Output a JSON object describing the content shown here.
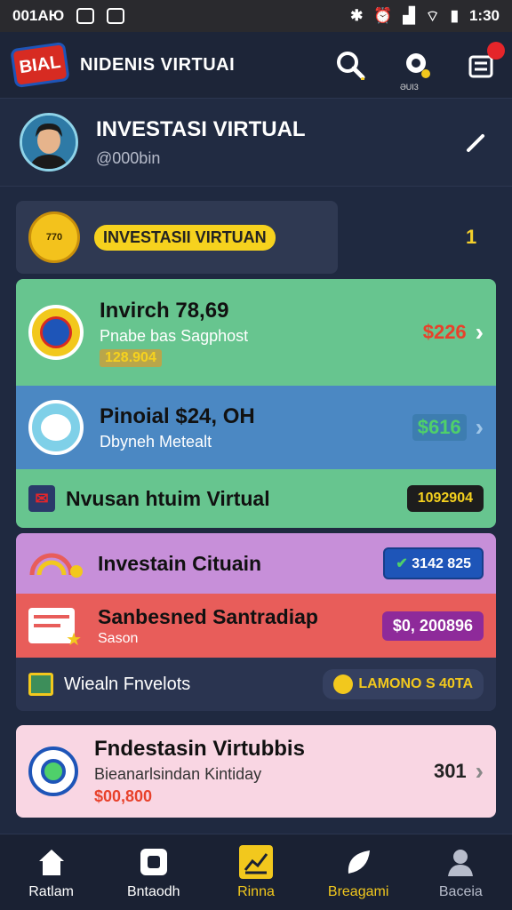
{
  "status_bar": {
    "left_text": "001AЮ",
    "time": "1:30"
  },
  "app_bar": {
    "logo_text": "BIAL",
    "title": "NIDENIS VIRTUAI",
    "notification_label": "ƏUI3"
  },
  "profile": {
    "name": "INVESTASI VIRTUAL",
    "handle": "@000bin"
  },
  "summary": {
    "coin_text": "770",
    "label": "INVESTASII VIRTUAN",
    "count": "1"
  },
  "group1": [
    {
      "title": "Invirch 78,69",
      "subtitle": "Pnabe bas Sagphost",
      "tag": "128.904",
      "value": "$226",
      "value_color": "#e8412b"
    },
    {
      "title": "Pinoial $24, OH",
      "subtitle": "Dbyneh Metealt",
      "value": "$616",
      "value_color": "#4fd06a"
    },
    {
      "title": "Nvusan htuim Virtual",
      "pill": "1092904"
    }
  ],
  "group2": [
    {
      "title": "Investain Cituain",
      "pill": "3142 825"
    },
    {
      "title": "Sanbesned Santradiap",
      "subtitle": "Sason",
      "pill": "$0, 200896"
    },
    {
      "title": "Wiealn Fnvelots",
      "pill": "LAMONO S 40TA"
    }
  ],
  "card3": {
    "title": "Fndestasin Virtubbis",
    "subtitle": "Bieanarlsindan Kintiday",
    "amount": "$00,800",
    "value": "301"
  },
  "nav": [
    {
      "label": "Ratlam",
      "icon": "home-icon"
    },
    {
      "label": "Bntaodh",
      "icon": "wallet-icon"
    },
    {
      "label": "Rinna",
      "icon": "chart-icon",
      "active": true
    },
    {
      "label": "Breagami",
      "icon": "leaf-icon"
    },
    {
      "label": "Baceia",
      "icon": "user-icon"
    }
  ],
  "colors": {
    "green_row": "#67c58f",
    "blue_row": "#4b88c3",
    "purple_row": "#c78fd9",
    "red_row": "#e85d5a",
    "pink_card": "#f9d6e3",
    "active_nav": "#f2c81d"
  }
}
